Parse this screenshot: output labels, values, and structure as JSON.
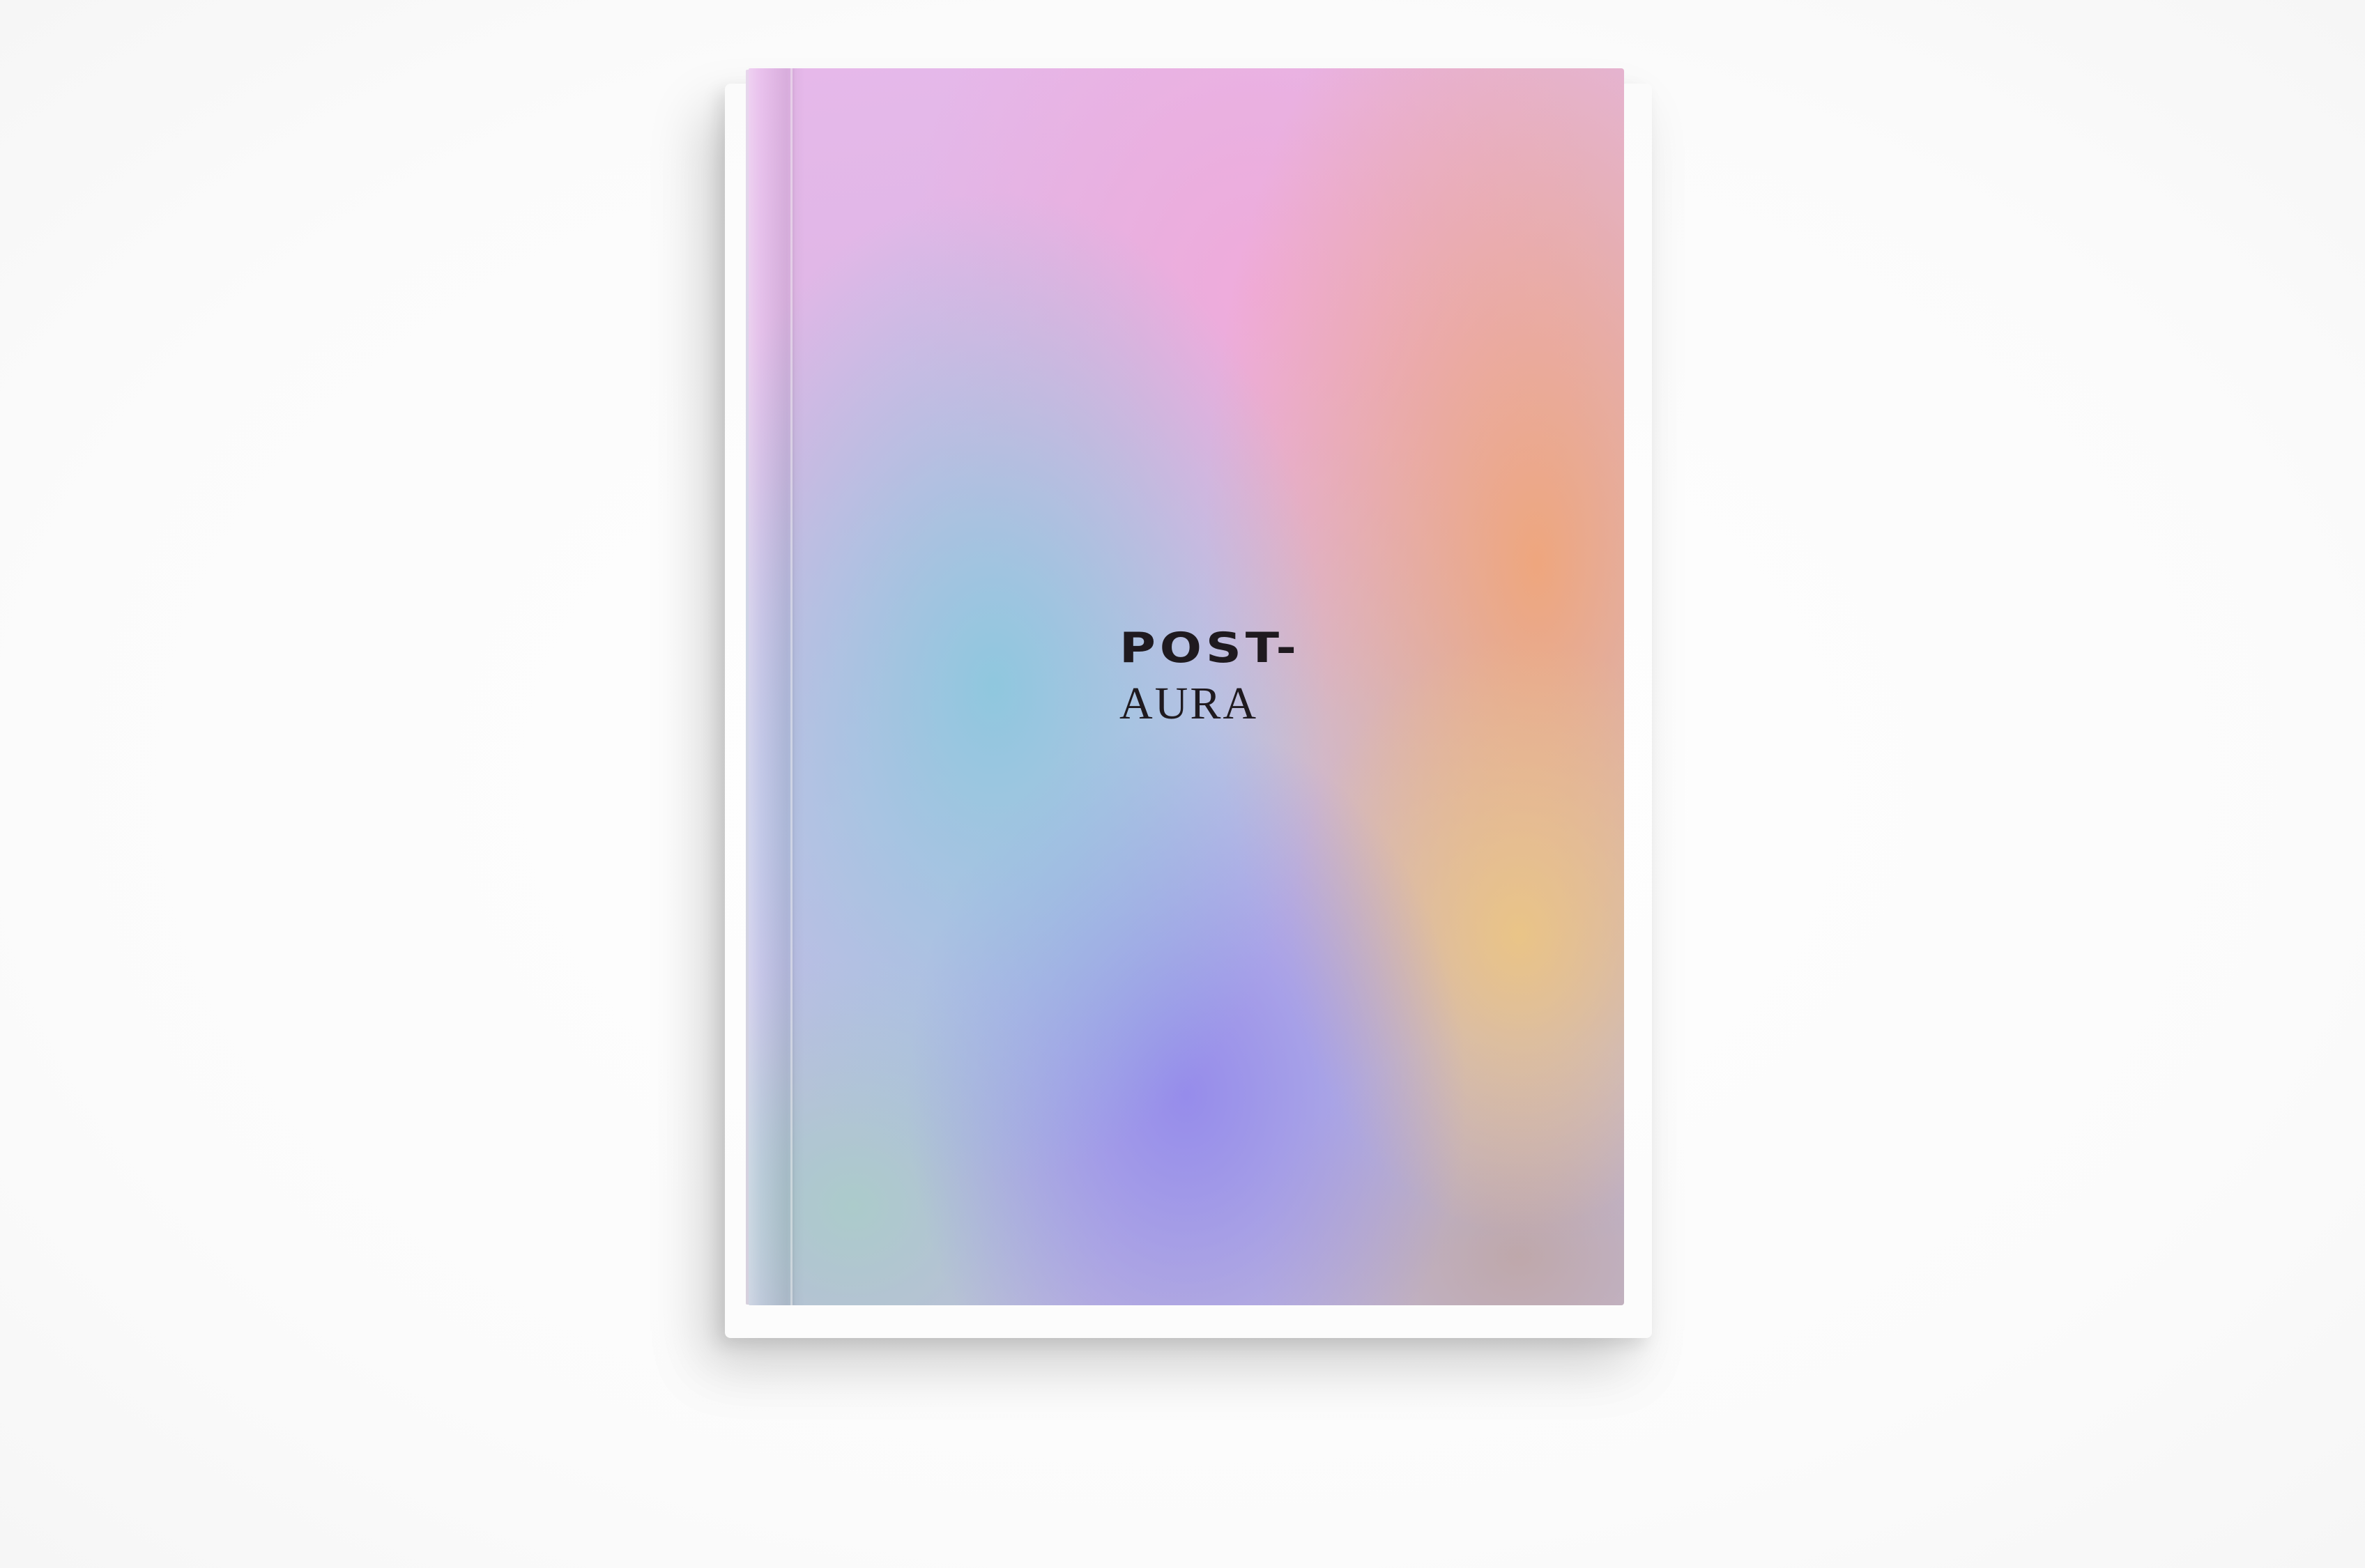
{
  "book": {
    "title_line_1": "POST-",
    "title_line_2": "AURA",
    "palette": [
      "#e6b8ea",
      "#8cc8de",
      "#968ceb",
      "#f0a578",
      "#ecc682",
      "#f0aada"
    ]
  }
}
